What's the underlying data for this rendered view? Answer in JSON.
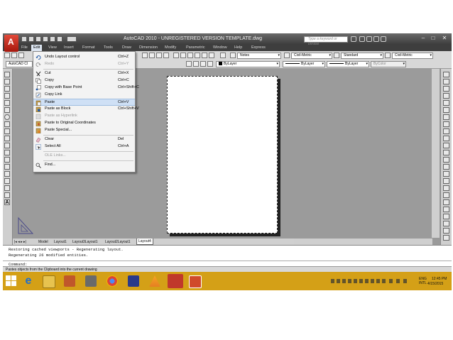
{
  "title": "AutoCAD 2010 - UNREGISTERED VERSION     TEMPLATE.dwg",
  "search_placeholder": "Type a keyword or phrase",
  "window_controls": {
    "minimize": "–",
    "restore": "□",
    "close": "✕"
  },
  "menubar": [
    "File",
    "Edit",
    "View",
    "Insert",
    "Format",
    "Tools",
    "Draw",
    "Dimension",
    "Modify",
    "Parametric",
    "Window",
    "Help",
    "Express"
  ],
  "active_menu": "Edit",
  "toolbar1": {
    "text_style": "Notes",
    "dim_style": "Civil-Metric",
    "table_style": "Standard",
    "multileader_style": "Civil-Metric"
  },
  "toolbar2": {
    "workspace": "AutoCAD Cl",
    "color": "ByLayer",
    "linetype": "ByLayer",
    "lineweight": "ByLayer",
    "plotstyle": "ByColor"
  },
  "edit_menu": [
    {
      "label": "Undo Layout control",
      "shortcut": "Ctrl+Z",
      "icon": "undo-icon",
      "enabled": true
    },
    {
      "label": "Redo",
      "shortcut": "Ctrl+Y",
      "icon": "redo-icon",
      "enabled": false
    },
    {
      "label": "Cut",
      "shortcut": "Ctrl+X",
      "icon": "cut-icon",
      "enabled": true
    },
    {
      "label": "Copy",
      "shortcut": "Ctrl+C",
      "icon": "copy-icon",
      "enabled": true
    },
    {
      "label": "Copy with Base Point",
      "shortcut": "Ctrl+Shift+C",
      "icon": "copy-base-icon",
      "enabled": true
    },
    {
      "label": "Copy Link",
      "shortcut": "",
      "icon": "copy-link-icon",
      "enabled": true
    },
    {
      "label": "Paste",
      "shortcut": "Ctrl+V",
      "icon": "paste-icon",
      "enabled": true
    },
    {
      "label": "Paste as Block",
      "shortcut": "Ctrl+Shift+V",
      "icon": "paste-block-icon",
      "enabled": true
    },
    {
      "label": "Paste as Hyperlink",
      "shortcut": "",
      "icon": "paste-hyperlink-icon",
      "enabled": false
    },
    {
      "label": "Paste to Original Coordinates",
      "shortcut": "",
      "icon": "paste-original-icon",
      "enabled": true
    },
    {
      "label": "Paste Special...",
      "shortcut": "",
      "icon": "paste-special-icon",
      "enabled": true
    },
    {
      "label": "Clear",
      "shortcut": "Del",
      "icon": "eraser-icon",
      "enabled": true
    },
    {
      "label": "Select All",
      "shortcut": "Ctrl+A",
      "icon": "select-all-icon",
      "enabled": true
    },
    {
      "label": "OLE Links...",
      "shortcut": "",
      "icon": "",
      "enabled": false
    },
    {
      "label": "Find...",
      "shortcut": "",
      "icon": "find-icon",
      "enabled": true
    }
  ],
  "highlighted_item": "Paste",
  "layout_tabs": [
    "Model",
    "Layout1",
    "Layout3Layout1",
    "Layout2Layout1",
    "Layout4"
  ],
  "active_tab": "Layout4",
  "command_history": [
    "Restoring cached viewports - Regenerating layout.",
    "Regenerating 26 modified entities."
  ],
  "command_prompt": "Command:",
  "status_text": "Pastes objects from the Clipboard into the current drawing",
  "clock": {
    "lang": "ENG",
    "region": "INTL",
    "time": "12:45 PM",
    "date": "4/15/2015"
  },
  "colors": {
    "taskbar": "#d4a017",
    "title_bar": "#3c3c3c",
    "menu_highlight": "#cfe0f5",
    "drawing_bg": "#9b9b9b"
  }
}
